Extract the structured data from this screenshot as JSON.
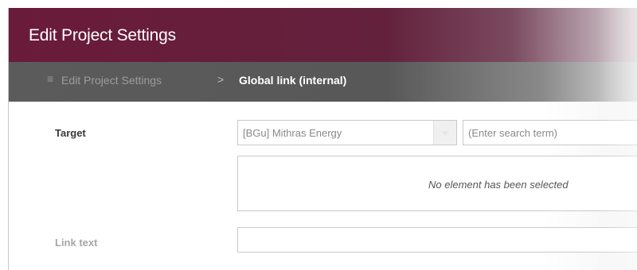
{
  "dialog": {
    "title": "Edit Project Settings"
  },
  "breadcrumb": {
    "icon": "list-icon",
    "parent": "Edit Project Settings",
    "separator": ">",
    "current": "Global link (internal)"
  },
  "form": {
    "target_label": "Target",
    "project_select_value": "[BGu] Mithras Energy",
    "search_placeholder": "(Enter search term)",
    "selection_empty": "No element has been selected",
    "link_text_label": "Link text",
    "link_text_value": ""
  },
  "colors": {
    "title_bar": "#6a1b39",
    "breadcrumb_bar": "#5b5b5b"
  }
}
